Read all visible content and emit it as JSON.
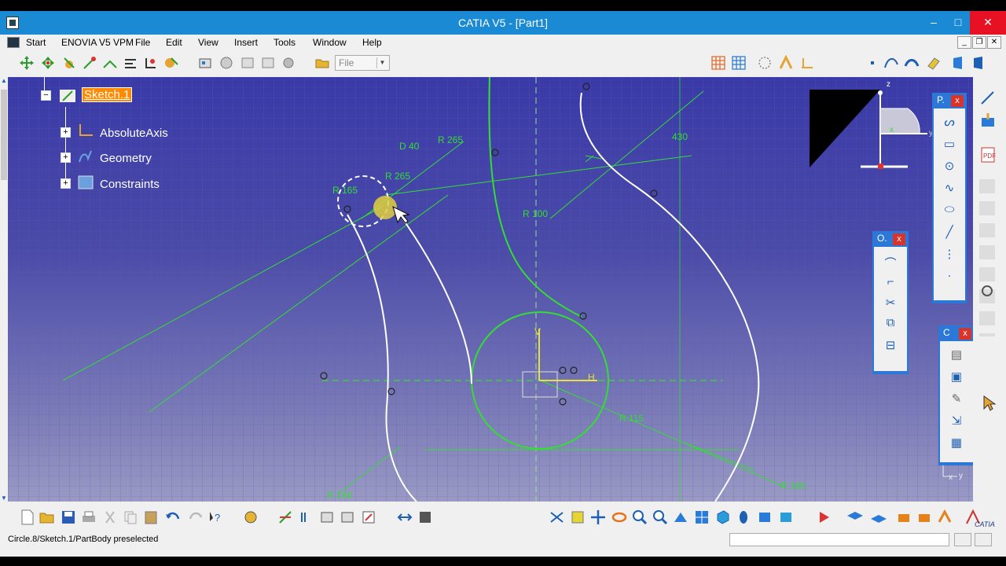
{
  "window": {
    "title": "CATIA V5 - [Part1]",
    "min": "–",
    "max": "□",
    "close": "✕"
  },
  "menu": {
    "items": [
      {
        "label": "Start",
        "key": "S"
      },
      {
        "label": "ENOVIA V5 VPM",
        "key": ""
      },
      {
        "label": "File",
        "key": "F"
      },
      {
        "label": "Edit",
        "key": "E"
      },
      {
        "label": "View",
        "key": "V"
      },
      {
        "label": "Insert",
        "key": "I"
      },
      {
        "label": "Tools",
        "key": "T"
      },
      {
        "label": "Window",
        "key": "W"
      },
      {
        "label": "Help",
        "key": "H"
      }
    ],
    "mdi_min": "_",
    "mdi_restore": "❐",
    "mdi_close": "✕"
  },
  "toolbar": {
    "file_select": "File"
  },
  "tree": {
    "sketch": "Sketch.1",
    "items": [
      "AbsoluteAxis",
      "Geometry",
      "Constraints"
    ]
  },
  "panels": {
    "profile": "P.",
    "operation": "O.",
    "constraint": "C"
  },
  "compass": {
    "z": "z",
    "x": "x",
    "y": "y"
  },
  "dims": {
    "d40": "D 40",
    "r265a": "R 265",
    "r265b": "R 265",
    "r165a": "R 165",
    "r100": "R 100",
    "d430": "430",
    "r140": "R 140",
    "r165b": "R 165",
    "r115": "R 115",
    "h": "H",
    "v": "V"
  },
  "status": {
    "text": "Circle.8/Sketch.1/PartBody preselected"
  },
  "colors": {
    "accent": "#1a8ad4",
    "sketch_bg": "#4a4aa8",
    "constraint": "#33dd33",
    "geometry": "#ffffff",
    "highlight": "#ff8a00"
  },
  "axis_hint": {
    "x": "x",
    "y": "y"
  }
}
